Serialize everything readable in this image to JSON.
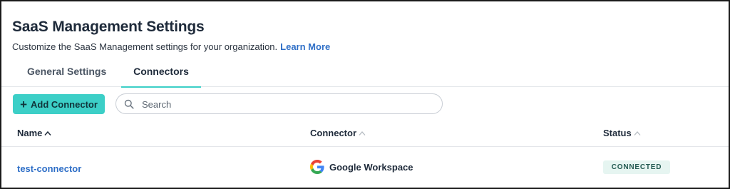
{
  "page": {
    "title": "SaaS Management Settings",
    "subtitle": "Customize the SaaS Management settings for your organization.",
    "learn_more": "Learn More"
  },
  "tabs": [
    {
      "label": "General Settings",
      "active": false
    },
    {
      "label": "Connectors",
      "active": true
    }
  ],
  "toolbar": {
    "add_label": "Add Connector",
    "add_icon": "plus-icon",
    "search_placeholder": "Search",
    "search_value": ""
  },
  "table": {
    "columns": [
      "Name",
      "Connector",
      "Status"
    ],
    "sort_active_column": "Name",
    "rows": [
      {
        "name": "test-connector",
        "connector": "Google Workspace",
        "connector_icon": "google-icon",
        "status": "CONNECTED"
      }
    ]
  },
  "colors": {
    "accent": "#3ccfc7",
    "link": "#2f6fc7",
    "status_bg": "#e6f5f1",
    "status_text": "#245b52"
  }
}
